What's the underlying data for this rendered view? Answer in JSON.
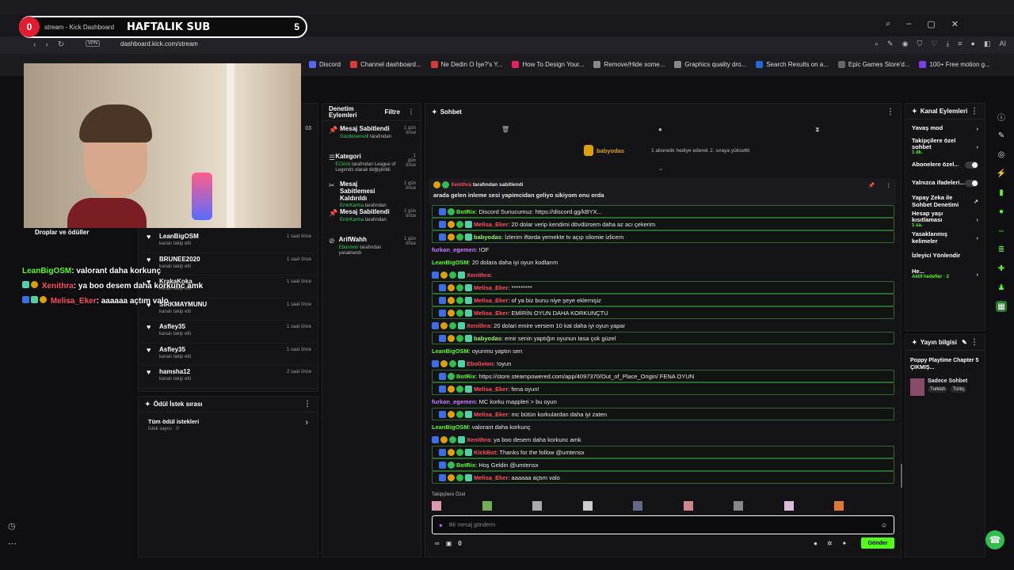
{
  "browser": {
    "tab_title": "stream - Kick Dashboard",
    "url": "dashboard.kick.com/stream",
    "vpn": "VPN",
    "bookmarks": [
      "Discord",
      "Channel dashboard...",
      "Ne Dedin O İşe?'s Y...",
      "How To Design Your...",
      "Remove/Hide some...",
      "Graphics quality dro...",
      "Search Results on a...",
      "Epic Games Store'd...",
      "100+ Free motion g..."
    ],
    "bookmark_colors": [
      "#5865f2",
      "#d93b3b",
      "#d93b3b",
      "#e91e63",
      "#888888",
      "#888888",
      "#1e6bd6",
      "#666666",
      "#7b3fe4"
    ]
  },
  "sub_widget": {
    "left_count": "0",
    "title": "HAFTALIK SUB",
    "right_count": "5"
  },
  "stream_overlay": {
    "drops_title": "Droplar ve ödüller",
    "chat": [
      {
        "user": "LeanBigOSM",
        "text": ": valorant daha korkunç"
      },
      {
        "user": "Xenithra",
        "text": ": ya boo desem daha korkunc amk"
      },
      {
        "user": "Melisa_Eker",
        "text": ": aaaaaa açtım valo"
      }
    ]
  },
  "events": {
    "items": [
      {
        "name": "LeanBigOSM",
        "desc": "kanalı takip etti",
        "time": "1 saat önce"
      },
      {
        "name": "BRUNEE2020",
        "desc": "kanalı takip etti",
        "time": "1 saat önce"
      },
      {
        "name": "KrakaKoka",
        "desc": "kanalı takip etti",
        "time": "1 saat önce"
      },
      {
        "name": "SIRKMAYMUNU",
        "desc": "kanalı takip etti",
        "time": "1 saat önce"
      },
      {
        "name": "Asfley35",
        "desc": "kanalı takip etti",
        "time": "1 saat önce"
      },
      {
        "name": "Asfley35",
        "desc": "kanalı takip etti",
        "time": "1 saat önce"
      },
      {
        "name": "hamsha12",
        "desc": "kanalı takip etti",
        "time": "2 saat önce"
      }
    ],
    "side_times": [
      "03"
    ]
  },
  "reward_queue": {
    "title": "Ödül İstek sırası",
    "all": "Tüm ödül istekleri",
    "count": "İstek sayısı · 0"
  },
  "mod_actions": {
    "title": "Denetim Eylemleri",
    "filter": "Filtre",
    "items": [
      {
        "title": "Mesaj Sabitlendi",
        "actor": "Gozdecensoll",
        "rest": "tarafından",
        "time": "1 gün önce"
      },
      {
        "title": "Kategori",
        "actor": "EClock",
        "rest": "tarafından League of Legends olarak değiştirildi",
        "time": "1 gün önce"
      },
      {
        "title": "Mesaj Sabitlemesi Kaldırıldı",
        "actor": "EmirKarma",
        "rest": "tarafından",
        "time": "1 gün önce"
      },
      {
        "title": "Mesaj Sabitlendi",
        "actor": "EmirKarma",
        "rest": "tarafından",
        "time": "1 gün önce"
      },
      {
        "title": "ArifWahh",
        "actor": "Ebonivon",
        "rest": "tarafından yasaklandı",
        "time": "1 gün önce"
      }
    ]
  },
  "chat": {
    "title": "Sohbet",
    "gift_user": "babyodas",
    "gift_text": "1 abonelik hediye ederek 2. sıraya yükseltti",
    "pinned_by": "Xenithra",
    "pinned_suffix": "tarafından sabitlendi",
    "pinned_text": "arada gelen inleme sesi yapimcidan geliyo sikiyom onu orda",
    "messages": [
      {
        "user": "BotRix",
        "cls": "u-green",
        "text": ": Discord Sunucumuz: https://discord.gg/kBYX..."
      },
      {
        "user": "Melisa_Eker",
        "cls": "u-red",
        "text": ": 20 dolar verip kendimi dövdürsem daha az acı çekerim"
      },
      {
        "user": "babyodas",
        "cls": "u-lgreen",
        "text": ": İzlerim iftarda yemekte tv açıp silomie izlicem"
      },
      {
        "user": "furkan_egemen",
        "cls": "u-purple",
        "text": ": !OF"
      },
      {
        "user": "LeanBigOSM",
        "cls": "u-green",
        "text": ": 20 dolara daha iyi oyun kodlarım"
      },
      {
        "user": "Xenithra",
        "cls": "u-red",
        "text": ":"
      },
      {
        "user": "Melisa_Eker",
        "cls": "u-red",
        "text": ": *********"
      },
      {
        "user": "Melisa_Eker",
        "cls": "u-red",
        "text": ": of ya biz bunu niye şeye eklemişiz"
      },
      {
        "user": "Melisa_Eker",
        "cls": "u-red",
        "text": ": EMİRİN OYUN DAHA KORKUNÇTU"
      },
      {
        "user": "Xenithra",
        "cls": "u-red",
        "text": ": 20 dolari emire versem 10 kat daha iyi oyun yapar"
      },
      {
        "user": "babyodas",
        "cls": "u-lgreen",
        "text": ": emir senin yaptığın oyunun tasa çok güzel"
      },
      {
        "user": "LeanBigOSM",
        "cls": "u-green",
        "text": ": oyunmu yaptın sen"
      },
      {
        "user": "Ebolivion",
        "cls": "u-red",
        "text": ": !oyun"
      },
      {
        "user": "BotRix",
        "cls": "u-green",
        "text": ": https://store.steampowered.com/app/4097370/Out_of_Place_Origin/ FENA OYUN"
      },
      {
        "user": "Melisa_Eker",
        "cls": "u-red",
        "text": ": fena oyun!"
      },
      {
        "user": "furkan_egemen",
        "cls": "u-purple",
        "text": ": MC korku mappleri > bu oyun"
      },
      {
        "user": "Melisa_Eker",
        "cls": "u-red",
        "text": ": mc bütün korkulardan daha iyi zaten"
      },
      {
        "user": "LeanBigOSM",
        "cls": "u-green",
        "text": ": valorant daha korkunç"
      },
      {
        "user": "Xenithra",
        "cls": "u-red",
        "text": ": ya boo desem daha korkunc amk"
      },
      {
        "user": "KickBot",
        "cls": "u-red",
        "text": ": Thanks for the follow @umtensx"
      },
      {
        "user": "BotRix",
        "cls": "u-green",
        "text": ": Hoş Geldin @umtensx"
      },
      {
        "user": "Melisa_Eker",
        "cls": "u-red",
        "text": ": aaaaaa açtım valo"
      }
    ],
    "follower_label": "Takipçilere Özel",
    "input_placeholder": "Bir mesaj gönderin",
    "points": "0",
    "send": "Gönder"
  },
  "channel_actions": {
    "title": "Kanal Eylemleri",
    "rows": [
      {
        "label": "Yavaş mod",
        "type": "chev"
      },
      {
        "label": "Takipçilere özel sohbet",
        "sub": "1 dk.",
        "type": "chev"
      },
      {
        "label": "Abonelere özel...",
        "type": "toggle"
      },
      {
        "label": "Yalnızca ifadeleri...",
        "type": "toggle"
      },
      {
        "label": "Yapay Zeka ile Sohbet Denetimi",
        "type": "ext"
      },
      {
        "label": "Hesap yaşı kısıtlaması",
        "sub": "1 sa.",
        "type": "chev"
      },
      {
        "label": "Yasaklanmış kelimeler",
        "type": "chev"
      },
      {
        "label": "İzleyici Yönlendir",
        "type": "none"
      },
      {
        "label": "He...",
        "sub": "Aktif hedefler · 2",
        "type": "chev"
      }
    ]
  },
  "stream_info": {
    "title": "Yayın bilgisi",
    "stream_title": "Poppy Playtime Chapter 5 ÇIKMIŞ...",
    "category": "Sadece Sohbet",
    "tags": [
      "Turkish",
      "Türkç"
    ]
  }
}
